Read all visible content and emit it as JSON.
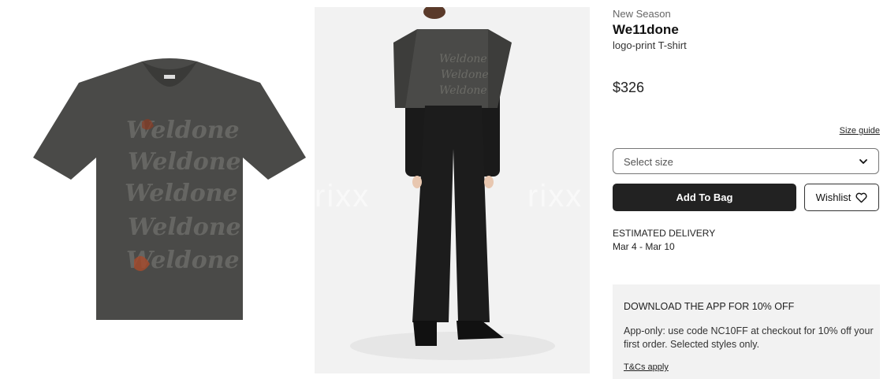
{
  "gallery": {
    "watermark_left": "rixx",
    "watermark_right": "rixx"
  },
  "product": {
    "tag": "New Season",
    "brand": "We11done",
    "description": "logo-print T-shirt",
    "price": "$326"
  },
  "size": {
    "guide_label": "Size guide",
    "placeholder": "Select size"
  },
  "actions": {
    "add_to_bag": "Add To Bag",
    "wishlist": "Wishlist"
  },
  "delivery": {
    "label": "ESTIMATED DELIVERY",
    "dates": "Mar 4 - Mar 10"
  },
  "promo": {
    "title": "DOWNLOAD THE APP FOR 10% OFF",
    "body": "App-only: use code NC10FF at checkout for 10% off your first order. Selected styles only.",
    "link": "T&Cs apply"
  },
  "colors": {
    "button_dark": "#222222",
    "promo_bg": "#f2f2f2"
  },
  "icons": {
    "chevron": "chevron-down-icon",
    "heart": "heart-icon"
  }
}
